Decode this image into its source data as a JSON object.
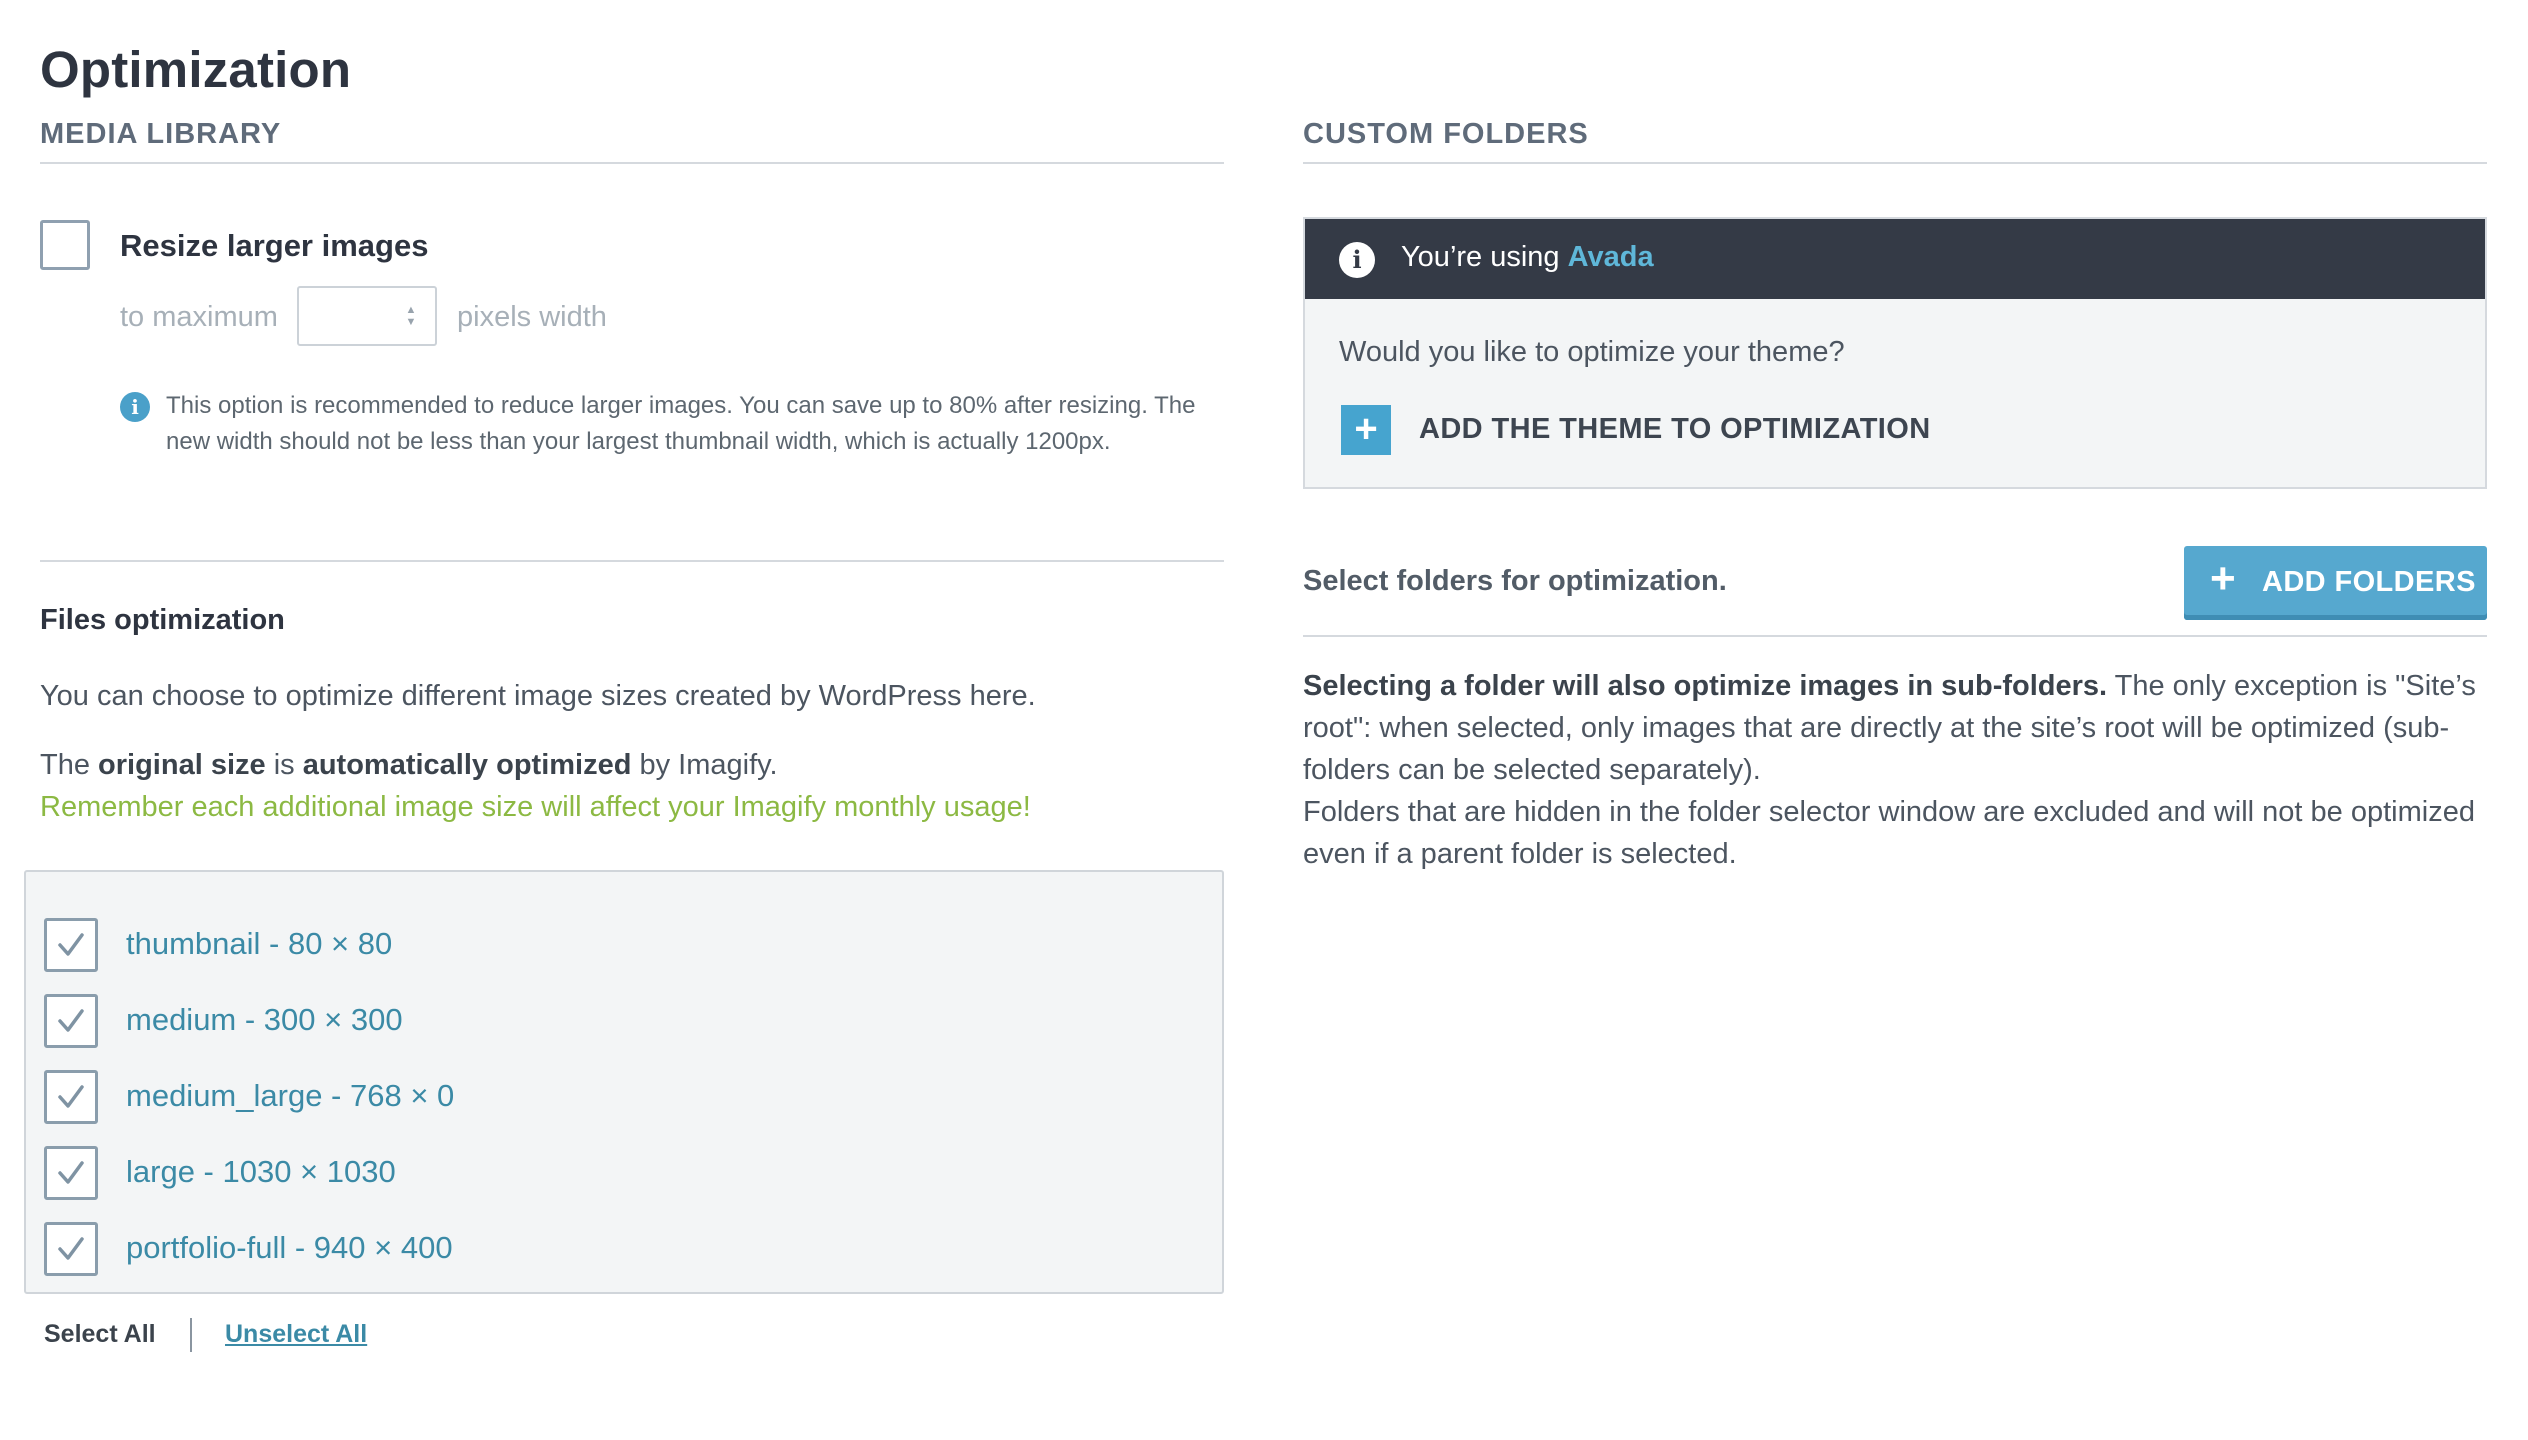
{
  "page": {
    "title": "Optimization"
  },
  "media_library": {
    "heading": "MEDIA LIBRARY",
    "resize": {
      "label": "Resize larger images",
      "prefix": "to maximum",
      "value": "",
      "suffix": "pixels width",
      "help": "This option is recommended to reduce larger images. You can save up to 80% after resizing. The new width should not be less than your largest thumbnail width, which is actually 1200px."
    },
    "files": {
      "title": "Files optimization",
      "description": "You can choose to optimize different image sizes created by WordPress here.",
      "orig_prefix": "The ",
      "orig_bold1": "original size",
      "orig_mid": " is ",
      "orig_bold2": "automatically optimized",
      "orig_suffix": " by Imagify.",
      "warning": "Remember each additional image size will affect your Imagify monthly usage!",
      "sizes": [
        {
          "label": "thumbnail - 80 × 80",
          "checked": true
        },
        {
          "label": "medium - 300 × 300",
          "checked": true
        },
        {
          "label": "medium_large - 768 × 0",
          "checked": true
        },
        {
          "label": "large - 1030 × 1030",
          "checked": true
        },
        {
          "label": "portfolio-full - 940 × 400",
          "checked": true
        }
      ],
      "select_all": "Select All",
      "unselect_all": "Unselect All"
    }
  },
  "custom_folders": {
    "heading": "CUSTOM FOLDERS",
    "theme": {
      "using_prefix": "You’re using ",
      "theme_name": "Avada",
      "question": "Would you like to optimize your theme?",
      "add_label": "ADD THE THEME TO OPTIMIZATION"
    },
    "select_label": "Select folders for optimization.",
    "add_folders_label": "ADD FOLDERS",
    "info_bold": "Selecting a folder will also optimize images in sub-folders.",
    "info_rest": " The only exception is \"Site’s root\": when selected, only images that are directly at the site’s root will be optimized (sub-folders can be selected separately).",
    "info_line2": "Folders that are hidden in the folder selector window are excluded and will not be optimized even if a parent folder is selected."
  },
  "colors": {
    "accent": "#46a4cf",
    "warning_green": "#8cb943",
    "dark_header": "#343a46",
    "link": "#3b8aa6"
  }
}
